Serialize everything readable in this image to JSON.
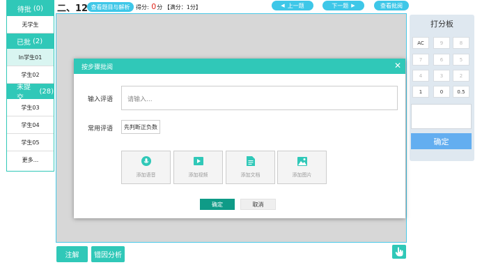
{
  "sidebar": {
    "pending": {
      "label": "待批",
      "count": "(0)"
    },
    "pending_items": [
      {
        "label": "无学生"
      }
    ],
    "graded": {
      "label": "已批",
      "count": "(2)"
    },
    "graded_items": [
      {
        "label": "In学生01"
      },
      {
        "label": "学生02"
      }
    ],
    "unsubmitted": {
      "label": "未提交",
      "count": "(28)"
    },
    "unsubmitted_items": [
      {
        "label": "学生03"
      },
      {
        "label": "学生04"
      },
      {
        "label": "学生05"
      },
      {
        "label": "更多..."
      }
    ]
  },
  "header": {
    "question_title": "二、12",
    "view_question_label": "查看题目与解析",
    "score_label": "得分:",
    "score_value": "0",
    "score_unit": "分",
    "full_score": "【满分：1分】",
    "prev_label": "上一题",
    "next_label": "下一题",
    "view_grading_label": "查看批阅"
  },
  "score_panel": {
    "title": "打分板",
    "keys": [
      "AC",
      "9",
      "8",
      "7",
      "6",
      "5",
      "4",
      "3",
      "2",
      "1",
      "0",
      "0.5"
    ],
    "confirm_label": "确定"
  },
  "modal": {
    "title": "按步骤批阅",
    "comment_label": "输入评语",
    "comment_placeholder": "请输入...",
    "common_label": "常用评语",
    "common_chip": "先判断正负数",
    "attachments": [
      {
        "label": "添加语音",
        "icon": "microphone-icon"
      },
      {
        "label": "添加视频",
        "icon": "video-icon"
      },
      {
        "label": "添加文档",
        "icon": "document-icon"
      },
      {
        "label": "添加图片",
        "icon": "image-icon"
      }
    ],
    "ok_label": "确定",
    "cancel_label": "取消"
  },
  "footer": {
    "annotate_label": "注解",
    "error_analysis_label": "错因分析"
  },
  "colors": {
    "teal": "#30c8b8",
    "dark_teal": "#0f9b87",
    "blue": "#3ec7e8",
    "score_red": "#e0251b",
    "confirm_blue": "#63aef0"
  }
}
